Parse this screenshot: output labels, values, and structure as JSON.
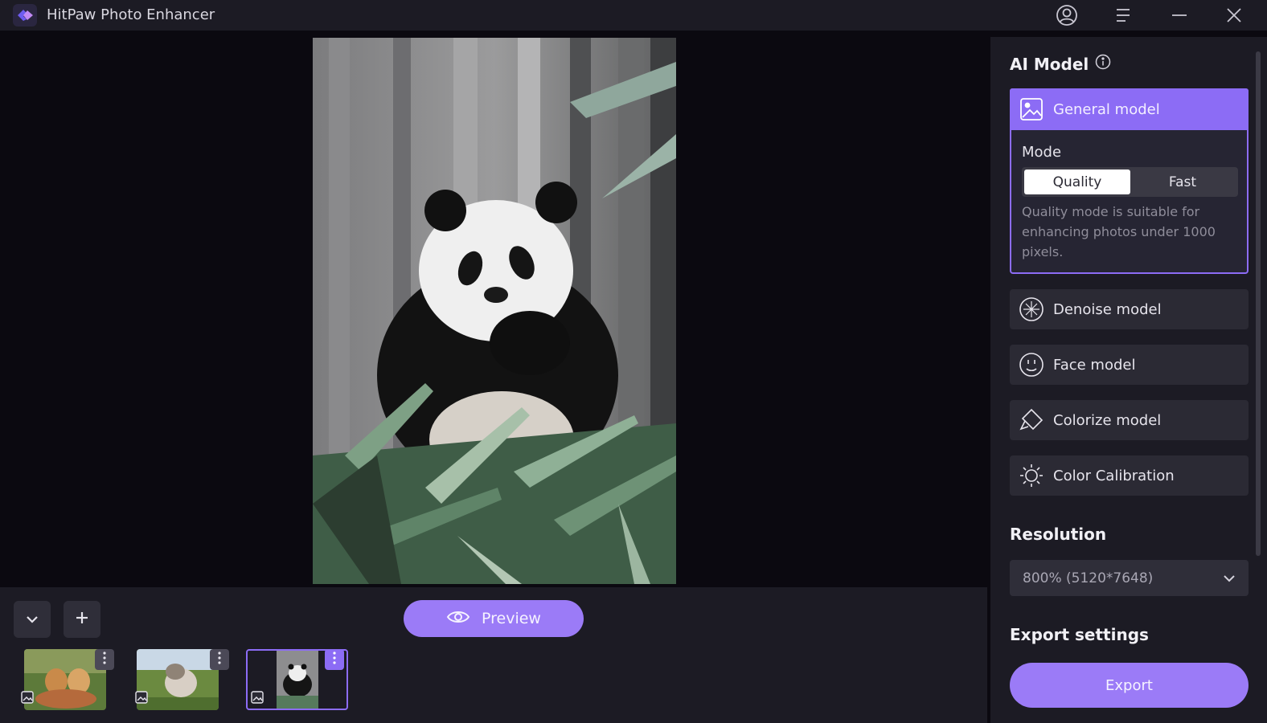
{
  "window": {
    "title": "HitPaw Photo Enhancer"
  },
  "preview": {
    "label": "Preview"
  },
  "thumbnails": [
    {
      "name": "dogs-photo"
    },
    {
      "name": "cat-photo"
    },
    {
      "name": "panda-photo",
      "selected": true
    }
  ],
  "right_panel": {
    "ai_model_title": "AI Model",
    "models": [
      {
        "label": "General model",
        "icon": "image-icon",
        "selected": true
      },
      {
        "label": "Denoise model",
        "icon": "denoise-icon"
      },
      {
        "label": "Face model",
        "icon": "face-icon"
      },
      {
        "label": "Colorize model",
        "icon": "colorize-icon"
      },
      {
        "label": "Color Calibration",
        "icon": "sun-icon"
      }
    ],
    "mode": {
      "label": "Mode",
      "options": [
        "Quality",
        "Fast"
      ],
      "selected": "Quality",
      "description": "Quality mode is suitable for enhancing photos under 1000 pixels."
    },
    "resolution_title": "Resolution",
    "resolution_value": "800% (5120*7648)",
    "export_settings_title": "Export settings",
    "export_label": "Export"
  },
  "colors": {
    "accent": "#8c6cf5",
    "button": "#9b7bf7",
    "panel": "#1c1b24",
    "background": "#0b0910"
  }
}
